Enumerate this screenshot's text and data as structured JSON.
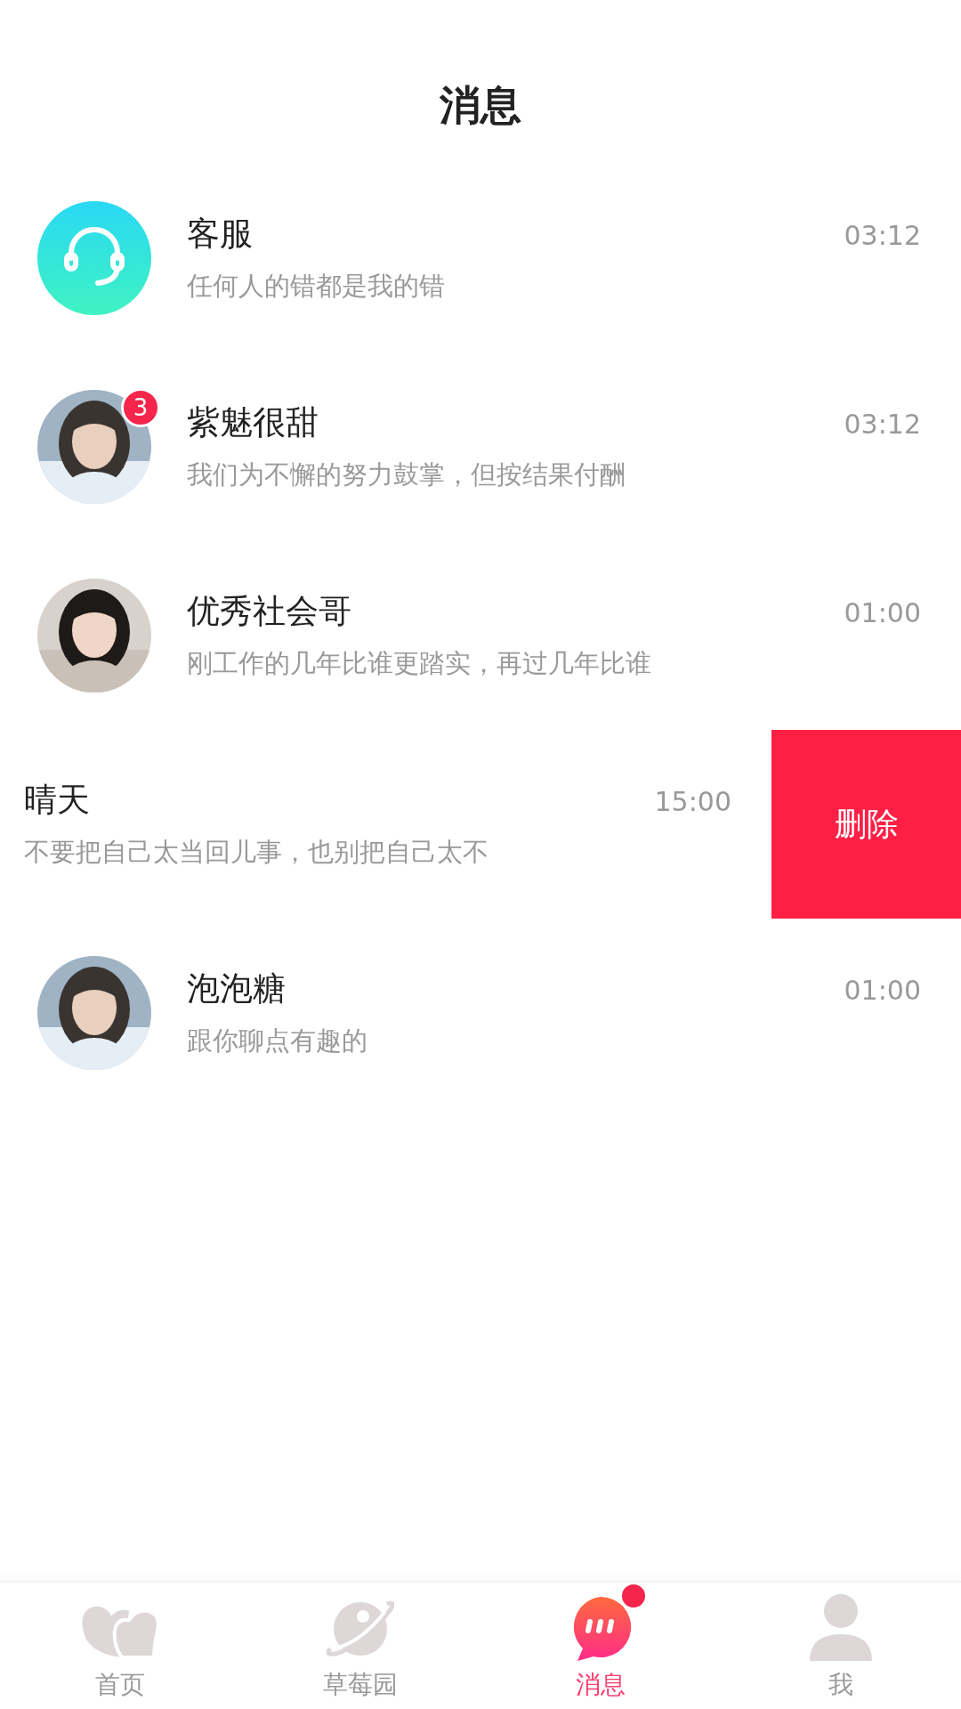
{
  "header": {
    "title": "消息"
  },
  "conversations": [
    {
      "kind": "support",
      "name": "客服",
      "preview": "任何人的错都是我的错",
      "time": "03:12",
      "swiped": false
    },
    {
      "kind": "person",
      "name": "紫魅很甜",
      "preview": "我们为不懈的努力鼓掌，但按结果付酬",
      "time": "03:12",
      "unread": "3",
      "swiped": false
    },
    {
      "kind": "person",
      "name": "优秀社会哥",
      "preview": "刚工作的几年比谁更踏实，再过几年比谁",
      "time": "01:00",
      "swiped": false
    },
    {
      "name": "晴天",
      "preview": "不要把自己太当回儿事，也别把自己太不",
      "time": "15:00",
      "swiped": true,
      "action": "删除"
    },
    {
      "kind": "person",
      "name": "泡泡糖",
      "preview": "跟你聊点有趣的",
      "time": "01:00",
      "swiped": false
    }
  ],
  "tabs": [
    {
      "kind": "home",
      "label": "首页",
      "selected": false,
      "dot": false
    },
    {
      "kind": "planet",
      "label": "草莓园",
      "selected": false,
      "dot": false
    },
    {
      "kind": "chat",
      "label": "消息",
      "selected": true,
      "dot": true
    },
    {
      "kind": "me",
      "label": "我",
      "selected": false,
      "dot": false
    }
  ]
}
